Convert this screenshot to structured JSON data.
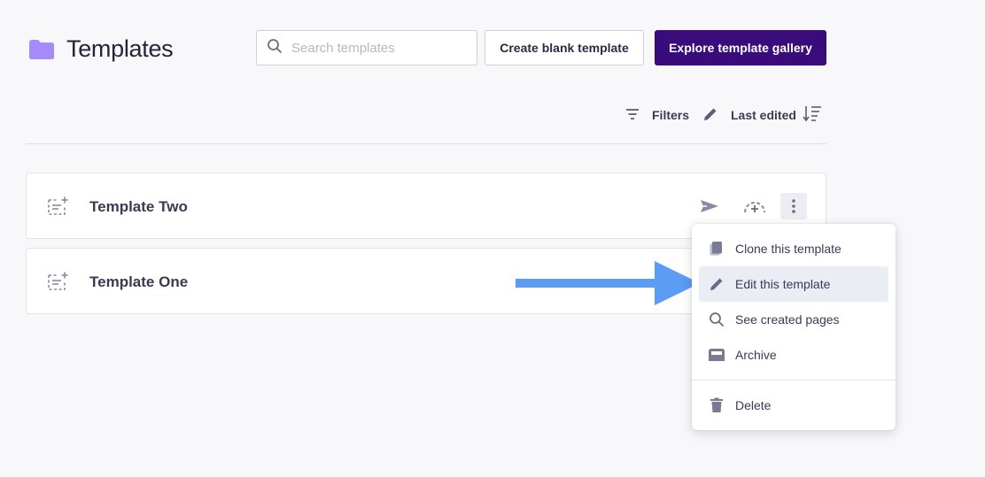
{
  "header": {
    "title": "Templates",
    "folder_icon": "folder-icon",
    "search_placeholder": "Search templates",
    "search_value": "",
    "create_blank_label": "Create blank template",
    "explore_gallery_label": "Explore template gallery"
  },
  "toolbar": {
    "filters_label": "Filters",
    "sort_label": "Last edited",
    "sort_direction_icon": "sort-descending-icon"
  },
  "templates": [
    {
      "name": "Template Two",
      "icon": "template-icon"
    },
    {
      "name": "Template One",
      "icon": "template-icon"
    }
  ],
  "row_actions": [
    "send-icon",
    "gauge-add-icon",
    "more-vertical-icon"
  ],
  "context_menu": {
    "items": [
      {
        "label": "Clone this template",
        "icon": "copy-icon"
      },
      {
        "label": "Edit this template",
        "icon": "pencil-icon",
        "highlighted": true
      },
      {
        "label": "See created pages",
        "icon": "search-icon"
      },
      {
        "label": "Archive",
        "icon": "archive-icon"
      }
    ],
    "danger_items": [
      {
        "label": "Delete",
        "icon": "trash-icon"
      }
    ]
  },
  "colors": {
    "accent": "#3a0b7a",
    "folder": "#a78bfa",
    "annotation_arrow": "#5b9cf5",
    "highlight": "#ebedf5"
  }
}
